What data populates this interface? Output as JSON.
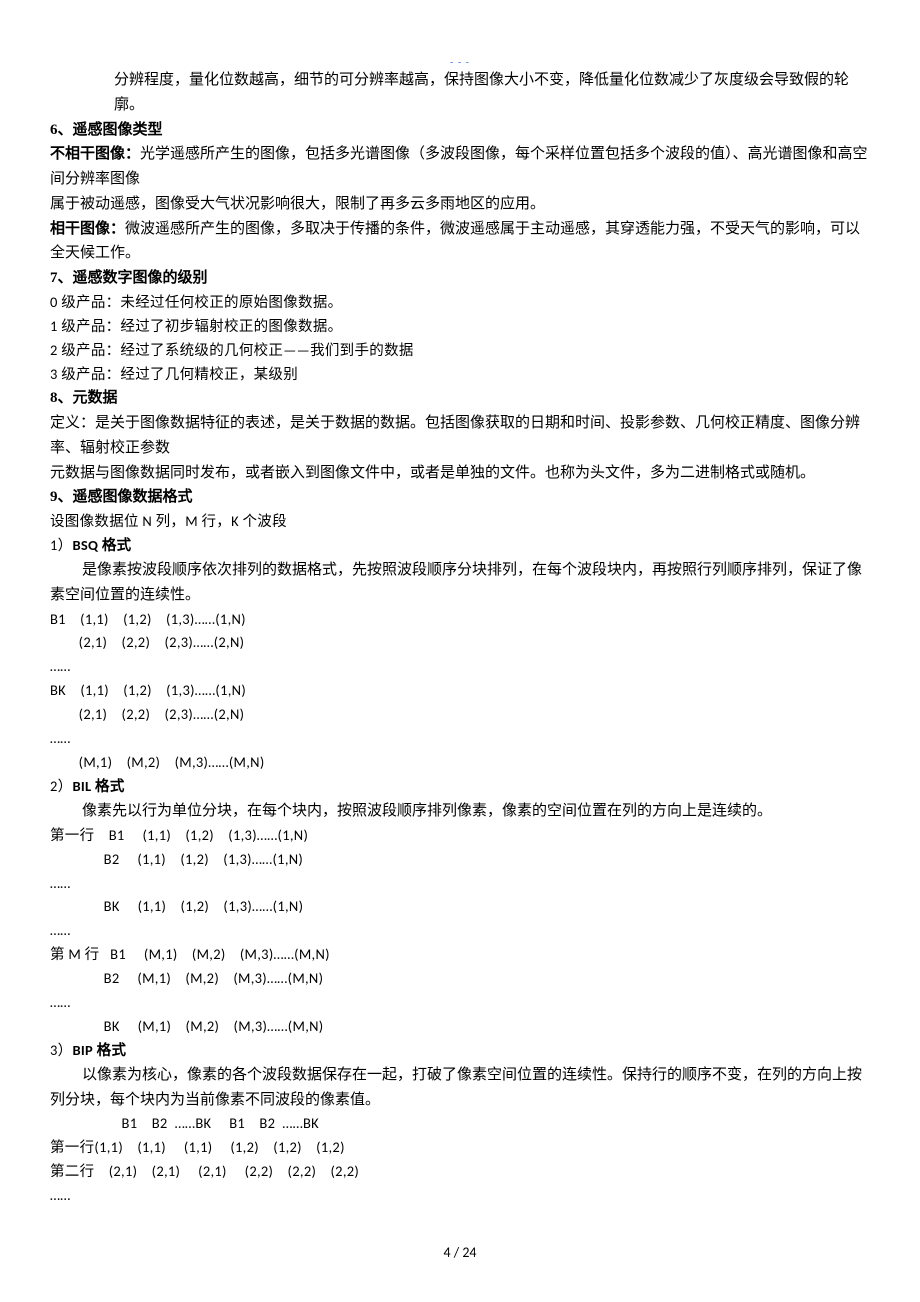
{
  "header_link": "- - -",
  "p1": "分辨程度，量化位数越高，细节的可分辨率越高，保持图像大小不变，降低量化位数减少了灰度级会导致假的轮廓。",
  "h6": "6、遥感图像类型",
  "p2a": "不相干图像：",
  "p2b": "光学遥感所产生的图像，包括多光谱图像（多波段图像，每个采样位置包括多个波段的值）、高光谱图像和高空间分辨率图像",
  "p3": "属于被动遥感，图像受大气状况影响很大，限制了再多云多雨地区的应用。",
  "p4a": "相干图像：",
  "p4b": "微波遥感所产生的图像，多取决于传播的条件，微波遥感属于主动遥感，其穿透能力强，不受天气的影响，可以全天候工作。",
  "h7": "7、遥感数字图像的级别",
  "p5": "0 级产品：未经过任何校正的原始图像数据。",
  "p6": "1 级产品：经过了初步辐射校正的图像数据。",
  "p7": "2 级产品：经过了系统级的几何校正——我们到手的数据",
  "p8": "3 级产品：经过了几何精校正，某级别",
  "h8": "8、元数据",
  "p9": "定义：是关于图像数据特征的表述，是关于数据的数据。包括图像获取的日期和时间、投影参数、几何校正精度、图像分辨率、辐射校正参数",
  "p10": "元数据与图像数据同时发布，或者嵌入到图像文件中，或者是单独的文件。也称为头文件，多为二进制格式或随机。",
  "h9": "9、遥感图像数据格式",
  "p11": "设图像数据位 N 列，M 行，K 个波段",
  "h9_1a": "1）",
  "h9_1b": "BSQ 格式",
  "p12": "是像素按波段顺序依次排列的数据格式，先按照波段顺序分块排列，在每个波段块内，再按照行列顺序排列，保证了像素空间位置的连续性。",
  "bsq1": "B1    (1,1)    (1,2)    (1,3)……(1,N)",
  "bsq2": "        (2,1)    (2,2)    (2,3)……(2,N)",
  "bsq3": "……",
  "bsq4": "BK    (1,1)    (1,2)    (1,3)……(1,N)",
  "bsq5": "        (2,1)    (2,2)    (2,3)……(2,N)",
  "bsq6": "……",
  "bsq7": "        (M,1)    (M,2)    (M,3)……(M,N)",
  "h9_2a": "2）",
  "h9_2b": "BIL 格式",
  "p13": "像素先以行为单位分块，在每个块内，按照波段顺序排列像素，像素的空间位置在列的方向上是连续的。",
  "bil1": "第一行    B1     (1,1)    (1,2)    (1,3)……(1,N)",
  "bil2": "               B2     (1,1)    (1,2)    (1,3)……(1,N)",
  "bil3": "……",
  "bil4": "               BK     (1,1)    (1,2)    (1,3)……(1,N)",
  "bil5": "……",
  "bil6": "第 M 行   B1     (M,1)    (M,2)    (M,3)……(M,N)",
  "bil7": "               B2     (M,1)    (M,2)    (M,3)……(M,N)",
  "bil8": "……",
  "bil9": "               BK     (M,1)    (M,2)    (M,3)……(M,N)",
  "h9_3a": "3）",
  "h9_3b": "BIP 格式",
  "p14": "以像素为核心，像素的各个波段数据保存在一起，打破了像素空间位置的连续性。保持行的顺序不变，在列的方向上按列分块，每个块内为当前像素不同波段的像素值。",
  "bip1": "                    B1    B2  ……BK     B1    B2  ……BK",
  "bip2": "第一行(1,1)    (1,1)     (1,1)     (1,2)    (1,2)    (1,2)",
  "bip3": "第二行    (2,1)    (2,1)     (2,1)     (2,2)    (2,2)    (2,2)",
  "bip4": "……",
  "footer": "4  /  24"
}
